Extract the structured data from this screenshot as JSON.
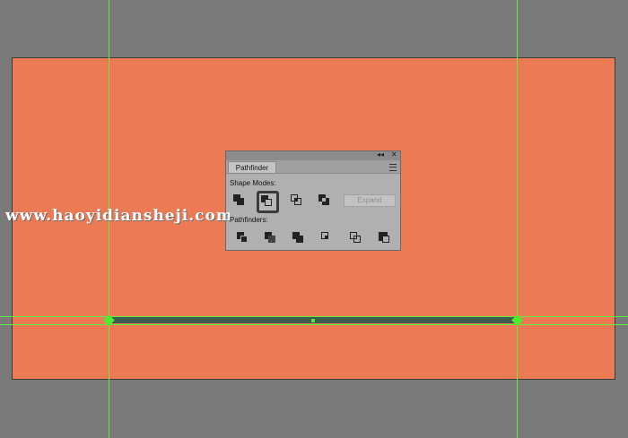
{
  "panel": {
    "collapse_glyph": "◂◂",
    "close_glyph": "✕",
    "tab_label": "Pathfinder",
    "menu_icon": "panel-menu-icon",
    "shape_modes_label": "Shape Modes:",
    "pathfinders_label": "Pathfinders:",
    "expand_label": "Expand",
    "shape_mode_buttons": [
      "unite",
      "minus-front",
      "intersect",
      "exclude"
    ],
    "pathfinder_buttons": [
      "divide",
      "trim",
      "merge",
      "crop",
      "outline",
      "minus-back"
    ]
  },
  "watermark": "www.haoyidiansheji.com",
  "colors": {
    "canvas": "#7a7a7a",
    "artboard": "#ec7b55",
    "bar": "#3d5a4d",
    "guide": "#5cf23c"
  }
}
